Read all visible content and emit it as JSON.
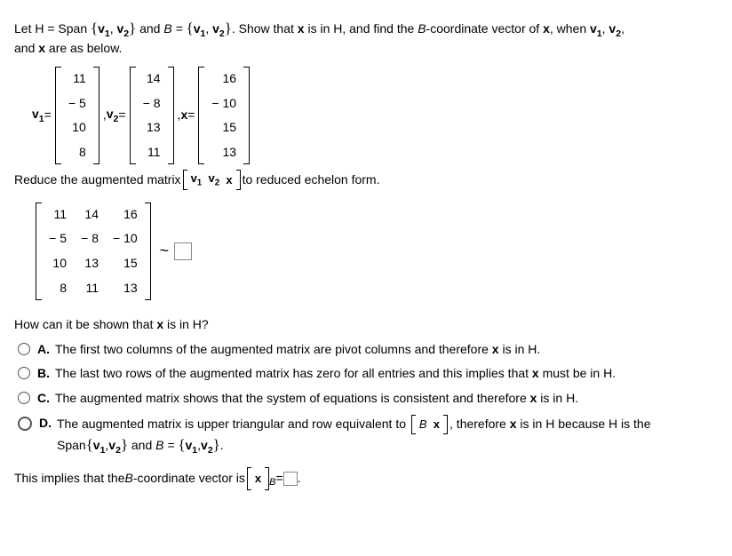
{
  "intro": {
    "part1": "Let H = Span ",
    "set1a": "{",
    "set1b": "}",
    "v1lbl": "v",
    "v1sub": "1",
    "v2lbl": "v",
    "v2sub": "2",
    "and": " and ",
    "Beq": "B = ",
    "part2": ". Show that ",
    "xbold": "x",
    "part3": " is in H, and find the ",
    "Bital": "B",
    "part4": "-coordinate vector of ",
    "part5": ", when ",
    "comma": ", ",
    "line2": "and ",
    "line2b": " are as below."
  },
  "vectors": {
    "v1_label": "v",
    "v1_sub": "1",
    "eq": " = ",
    "v2_label": "v",
    "v2_sub": "2",
    "x_label": "x",
    "x_eq": " = ",
    "v1": [
      "11",
      "− 5",
      "10",
      "8"
    ],
    "v2": [
      "14",
      "− 8",
      "13",
      "11"
    ],
    "x": [
      "16",
      "− 10",
      "15",
      "13"
    ],
    "sep": ", "
  },
  "reduce": {
    "pre": "Reduce the augmented matrix ",
    "mid_v1": "v",
    "mid_v1s": "1",
    "mid_v2": "v",
    "mid_v2s": "2",
    "mid_x": "x",
    "post": " to reduced echelon form."
  },
  "aug_matrix": [
    [
      "11",
      "14",
      "16"
    ],
    [
      "− 5",
      "− 8",
      "− 10"
    ],
    [
      "10",
      "13",
      "15"
    ],
    [
      "8",
      "11",
      "13"
    ]
  ],
  "tilde": "~",
  "question": "How can it be shown that x is in H?",
  "question_pre": "How can it be shown that ",
  "question_x": "x",
  "question_post": " is in H?",
  "choices": {
    "A": {
      "label": "A.",
      "text": "The first two columns of the augmented matrix are pivot columns and therefore ",
      "x": "x",
      "tail": " is in H."
    },
    "B": {
      "label": "B.",
      "text": "The last two rows of the augmented matrix has zero for all entries and this implies that ",
      "x": "x",
      "tail": " must be in H."
    },
    "C": {
      "label": "C.",
      "text": "The augmented matrix shows that the system of equations is consistent and therefore ",
      "x": "x",
      "tail": " is in H."
    },
    "D": {
      "label": "D.",
      "t1": "The augmented matrix is upper triangular and row equivalent to ",
      "br_B": "B",
      "br_x": "x",
      "t2": ", therefore ",
      "x": "x",
      "t3": " is in H because H is the Span",
      "set_open": "{",
      "v1": "v",
      "v1s": "1",
      "comma": ",",
      "v2": "v",
      "v2s": "2",
      "set_close": "}",
      "t4": " and ",
      "Beq": "B = ",
      "period": "."
    }
  },
  "final": {
    "t1": "This implies that the ",
    "B": "B",
    "t2": "-coordinate vector is ",
    "br_x": "x",
    "eq": " = "
  }
}
